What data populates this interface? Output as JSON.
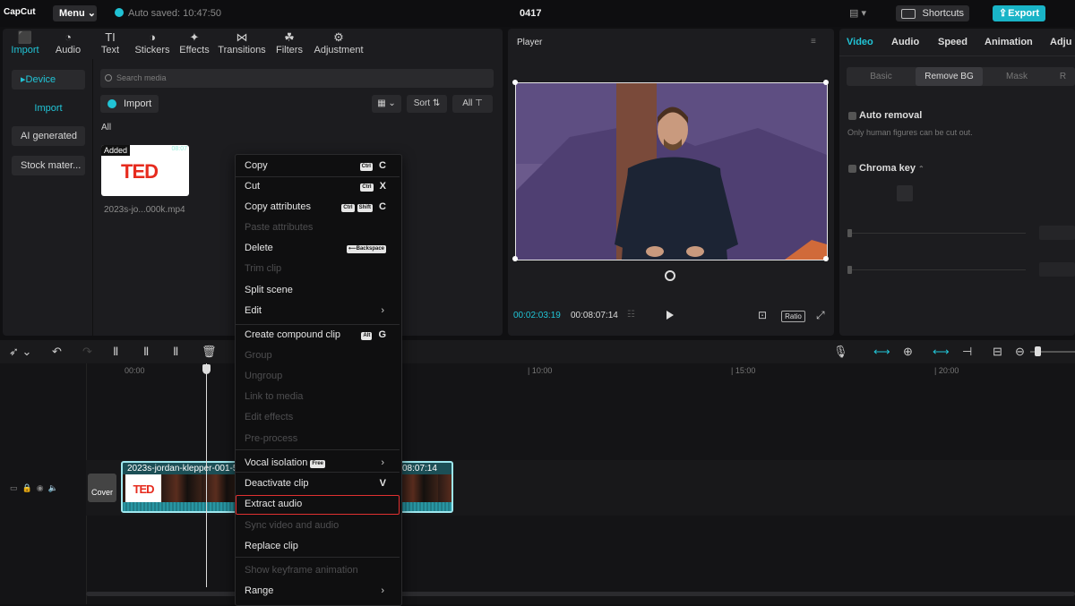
{
  "app": {
    "logo": "CapCut",
    "menu": "Menu",
    "autosave": "Auto saved: 10:47:50",
    "project": "0417",
    "shortcuts": "Shortcuts",
    "export": "Export"
  },
  "tools": [
    {
      "label": "Import",
      "icon": "import-icon",
      "glyph": "⬛"
    },
    {
      "label": "Audio",
      "icon": "audio-icon",
      "glyph": "◔"
    },
    {
      "label": "Text",
      "icon": "text-icon",
      "glyph": "TI"
    },
    {
      "label": "Stickers",
      "icon": "stickers-icon",
      "glyph": "◑"
    },
    {
      "label": "Effects",
      "icon": "effects-icon",
      "glyph": "✦"
    },
    {
      "label": "Transitions",
      "icon": "transitions-icon",
      "glyph": "⋈"
    },
    {
      "label": "Filters",
      "icon": "filters-icon",
      "glyph": "☘"
    },
    {
      "label": "Adjustment",
      "icon": "adjustment-icon",
      "glyph": "⚙"
    }
  ],
  "sidebar": {
    "device": "Device",
    "import": "Import",
    "ai": "AI generated",
    "stock": "Stock mater..."
  },
  "media": {
    "search_placeholder": "Search media",
    "import_btn": "Import",
    "sort": "Sort",
    "all_btn": "All",
    "all_label": "All",
    "thumb_added": "Added",
    "thumb_logo": "TED",
    "thumb_duration": "08:07",
    "filename": "2023s-jo...000k.mp4"
  },
  "player": {
    "title": "Player",
    "current": "00:02:03:19",
    "total": "00:08:07:14",
    "ratio": "Ratio"
  },
  "right": {
    "tabs": [
      "Video",
      "Audio",
      "Speed",
      "Animation",
      "Adju"
    ],
    "subtabs": [
      "Basic",
      "Remove BG",
      "Mask",
      "R"
    ],
    "auto_removal": "Auto removal",
    "auto_desc": "Only human figures can be cut out.",
    "chroma": "Chroma key"
  },
  "ruler": [
    "00:00",
    "| 10:00",
    "| 15:00",
    "| 20:00"
  ],
  "clip": {
    "name": "2023s-jordan-klepper-001-5",
    "logo": "TED",
    "end": "08:07:14",
    "cover": "Cover"
  },
  "context_menu": {
    "items": [
      {
        "label": "Copy",
        "keys": [
          "Ctrl"
        ],
        "letter": "C",
        "disabled": false
      },
      {
        "label": "Cut",
        "keys": [
          "Ctrl"
        ],
        "letter": "X",
        "disabled": false
      },
      {
        "label": "Copy attributes",
        "keys": [
          "Ctrl",
          "Shift"
        ],
        "letter": "C",
        "disabled": false
      },
      {
        "label": "Paste attributes",
        "keys": [],
        "letter": "",
        "disabled": true
      },
      {
        "label": "Delete",
        "keys": [
          "⟵Backspace"
        ],
        "letter": "",
        "disabled": false
      },
      {
        "label": "Trim clip",
        "keys": [],
        "letter": "",
        "disabled": true
      },
      {
        "label": "Split scene",
        "keys": [],
        "letter": "",
        "disabled": false
      },
      {
        "label": "Edit",
        "keys": [],
        "letter": "",
        "submenu": true,
        "disabled": false
      },
      {
        "label": "Create compound clip",
        "keys": [
          "Alt"
        ],
        "letter": "G",
        "disabled": false
      },
      {
        "label": "Group",
        "keys": [],
        "letter": "",
        "disabled": true
      },
      {
        "label": "Ungroup",
        "keys": [],
        "letter": "",
        "disabled": true
      },
      {
        "label": "Link to media",
        "keys": [],
        "letter": "",
        "disabled": true
      },
      {
        "label": "Edit effects",
        "keys": [],
        "letter": "",
        "disabled": true
      },
      {
        "label": "Pre-process",
        "keys": [],
        "letter": "",
        "disabled": true
      },
      {
        "label": "Vocal isolation",
        "badge": "Free",
        "keys": [],
        "letter": "",
        "submenu": true,
        "disabled": false
      },
      {
        "label": "Deactivate clip",
        "keys": [],
        "letter": "V",
        "disabled": false
      },
      {
        "label": "Extract audio",
        "keys": [],
        "letter": "",
        "disabled": false,
        "highlighted": true
      },
      {
        "label": "Sync video and audio",
        "keys": [],
        "letter": "",
        "disabled": true
      },
      {
        "label": "Replace clip",
        "keys": [],
        "letter": "",
        "disabled": false
      },
      {
        "label": "Show keyframe animation",
        "keys": [],
        "letter": "",
        "disabled": true
      },
      {
        "label": "Range",
        "keys": [],
        "letter": "",
        "submenu": true,
        "disabled": false
      }
    ]
  }
}
